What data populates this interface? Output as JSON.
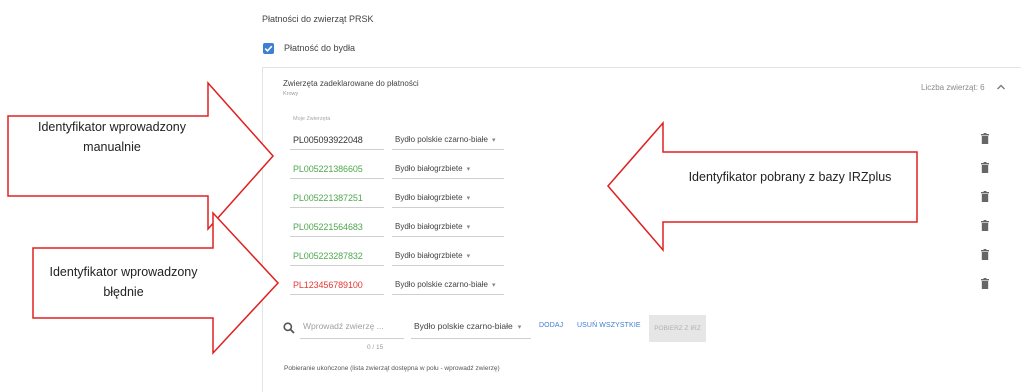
{
  "section_title": "Płatności do zwierząt PRSK",
  "checkbox": {
    "label": "Płatność do bydła",
    "checked": true
  },
  "panel": {
    "title": "Zwierzęta zadeklarowane do płatności",
    "subtitle": "Krowy",
    "count_label": "Liczba zwierząt: 6",
    "column_header": "Moje Zwierzęta"
  },
  "rows": [
    {
      "id": "PL005093922048",
      "breed": "Bydło polskie czarno-białe",
      "status": "manual"
    },
    {
      "id": "PL005221386605",
      "breed": "Bydło białogrzbiete",
      "status": "irz"
    },
    {
      "id": "PL005221387251",
      "breed": "Bydło białogrzbiete",
      "status": "irz"
    },
    {
      "id": "PL005221564683",
      "breed": "Bydło białogrzbiete",
      "status": "irz"
    },
    {
      "id": "PL005223287832",
      "breed": "Bydło białogrzbiete",
      "status": "irz"
    },
    {
      "id": "PL123456789100",
      "breed": "Bydło polskie czarno-białe",
      "status": "error"
    }
  ],
  "add_form": {
    "search_placeholder": "Wprowadź zwierzę ...",
    "counter": "0 / 15",
    "breed_value": "Bydło polskie czarno-białe",
    "add_label": "DODAJ",
    "remove_all_label": "USUŃ WSZYSTKIE",
    "fetch_label": "POBIERZ Z IRZ"
  },
  "status_text": "Pobieranie ukończone (lista zwierząt dostępna w polu - wprowadź zwierzę)",
  "callouts": {
    "manual": "Identyfikator wprowadzony manualnie",
    "irz": "Identyfikator pobrany z bazy IRZplus",
    "error": "Identyfikator wprowadzony błędnie"
  },
  "colors": {
    "accent": "#3e7fcf",
    "irz_green": "#4fa84f",
    "error_red": "#e53935",
    "callout_border": "#e02020"
  },
  "icons": [
    "check-icon",
    "chevron-up-icon",
    "trash-icon",
    "search-icon",
    "caret-down-icon"
  ]
}
